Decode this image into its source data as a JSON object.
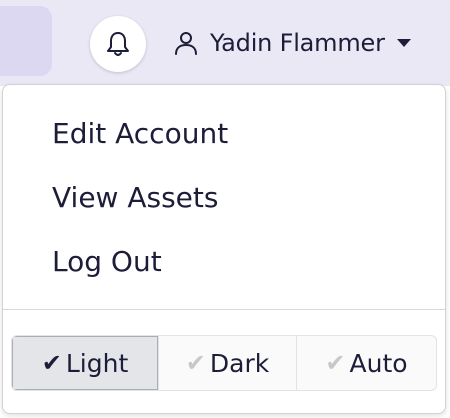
{
  "header": {
    "bell_icon": "bell-icon",
    "user_icon": "user-icon",
    "user_name": "Yadin Flammer",
    "caret_icon": "caret-down-icon"
  },
  "menu": {
    "items": [
      {
        "label": "Edit Account"
      },
      {
        "label": "View Assets"
      },
      {
        "label": "Log Out"
      }
    ]
  },
  "theme": {
    "selected": "Light",
    "options": [
      {
        "label": "Light",
        "check": "✔",
        "active": true
      },
      {
        "label": "Dark",
        "check": "✔",
        "active": false
      },
      {
        "label": "Auto",
        "check": "✔",
        "active": false
      }
    ]
  },
  "colors": {
    "header_bg": "#ebe8f6",
    "text": "#1d1d3a",
    "active_theme_bg": "#e3e5e8"
  }
}
